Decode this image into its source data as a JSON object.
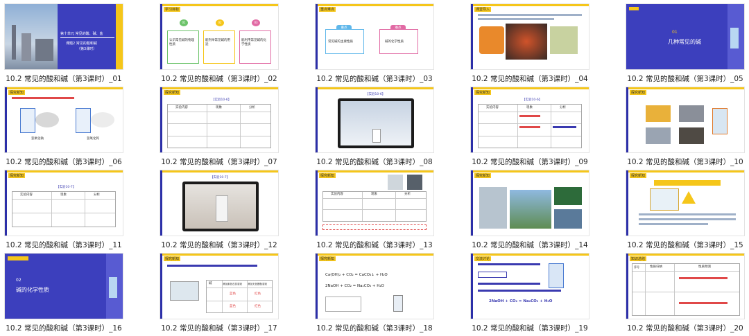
{
  "slides": [
    {
      "caption": "10.2 常见的酸和碱（第3课时）_01",
      "title": "第十单元 常见的酸、碱、盐",
      "subtitle": "课题2 常见的酸和碱",
      "subtitle2": "（第3课时）"
    },
    {
      "caption": "10.2 常见的酸和碱（第3课时）_02",
      "heading": "学习目标",
      "b1": "01",
      "b2": "02",
      "b3": "03",
      "t1": "认识常见碱的物理性质",
      "t2": "能列举常见碱的用途",
      "t3": "能利用常见碱的化学性质"
    },
    {
      "caption": "10.2 常见的酸和碱（第3课时）_03",
      "heading": "重点难点",
      "k1": "重点",
      "k2": "难点",
      "t1": "常见碱的主要性质",
      "t2": "碱的化学性质"
    },
    {
      "caption": "10.2 常见的酸和碱（第3课时）_04",
      "heading": "课堂导入"
    },
    {
      "caption": "10.2 常见的酸和碱（第3课时）_05",
      "num": "01",
      "title": "几种常见的碱"
    },
    {
      "caption": "10.2 常见的酸和碱（第3课时）_06",
      "heading": "探究新知",
      "l1": "氢氧化钠",
      "l2": "氢氧化钙"
    },
    {
      "caption": "10.2 常见的酸和碱（第3课时）_07",
      "heading": "探究新知",
      "tag": "【实验10-6】",
      "h1": "实验内容",
      "h2": "现象",
      "h3": "分析"
    },
    {
      "caption": "10.2 常见的酸和碱（第3课时）_08",
      "tag": "【实验10-6】"
    },
    {
      "caption": "10.2 常见的酸和碱（第3课时）_09",
      "heading": "探究新知",
      "tag": "【实验10-6】",
      "h1": "实验内容",
      "h2": "现象",
      "h3": "分析"
    },
    {
      "caption": "10.2 常见的酸和碱（第3课时）_10",
      "heading": "探究新知"
    },
    {
      "caption": "10.2 常见的酸和碱（第3课时）_11",
      "heading": "探究新知",
      "tag": "【实验10-7】",
      "h1": "实验内容",
      "h2": "现象",
      "h3": "分析"
    },
    {
      "caption": "10.2 常见的酸和碱（第3课时）_12",
      "tag": "【实验10-7】"
    },
    {
      "caption": "10.2 常见的酸和碱（第3课时）_13",
      "heading": "探究新知",
      "h1": "实验内容",
      "h2": "现象",
      "h3": "分析"
    },
    {
      "caption": "10.2 常见的酸和碱（第3课时）_14",
      "heading": "探究新知"
    },
    {
      "caption": "10.2 常见的酸和碱（第3课时）_15",
      "heading": "探究新知"
    },
    {
      "caption": "10.2 常见的酸和碱（第3课时）_16",
      "num": "02",
      "title": "碱的化学性质"
    },
    {
      "caption": "10.2 常见的酸和碱（第3课时）_17",
      "heading": "探究新知",
      "h1": "碱",
      "h2": "滴加紫色石蕊溶液",
      "h3": "滴加无色酚酞溶液",
      "r1": "蓝色",
      "r2": "红色",
      "r3": "蓝色",
      "r4": "红色"
    },
    {
      "caption": "10.2 常见的酸和碱（第3课时）_18",
      "heading": "探究新知",
      "eq1": "Ca(OH)₂ + CO₂ = CaCO₃↓ + H₂O",
      "eq2": "2NaOH + CO₂ = Na₂CO₃ + H₂O"
    },
    {
      "caption": "10.2 常见的酸和碱（第3课时）_19",
      "heading": "交流讨论",
      "eq": "2NaOH + CO₂ = Na₂CO₃ + H₂O"
    },
    {
      "caption": "10.2 常见的酸和碱（第3课时）_20",
      "heading": "知识总结",
      "h1": "序号",
      "h2": "性质归纳",
      "h3": "性质预测"
    }
  ]
}
